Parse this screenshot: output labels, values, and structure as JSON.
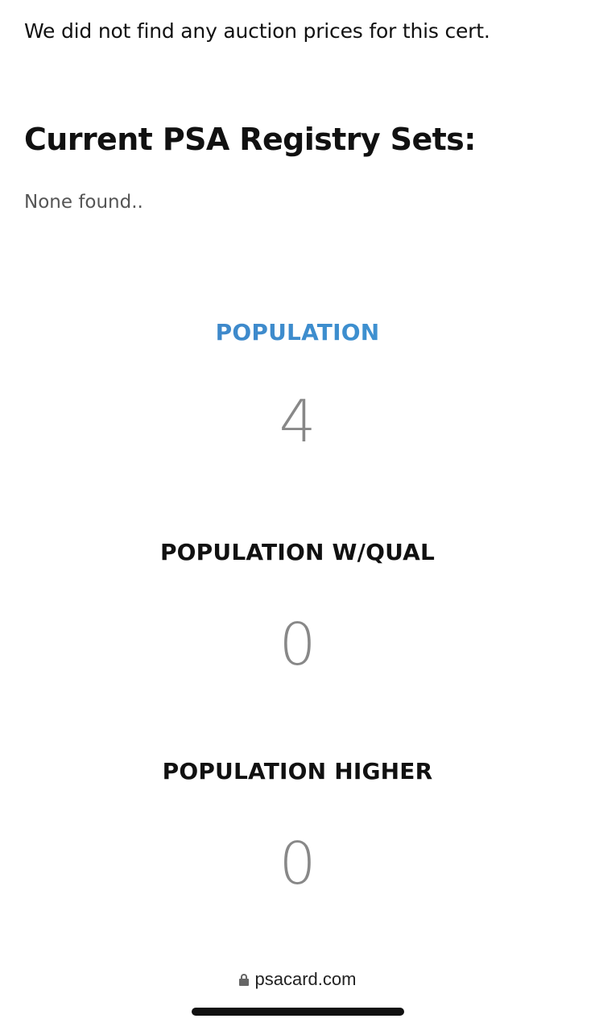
{
  "auction": {
    "message": "We did not find any auction prices for this cert."
  },
  "registry": {
    "heading": "Current PSA Registry Sets:",
    "empty_text": "None found.."
  },
  "population": {
    "label": "POPULATION",
    "value": "4",
    "accent_colors": [
      "#3f7fc4",
      "#49a3d8"
    ]
  },
  "population_qual": {
    "label": "POPULATION W/QUAL",
    "value": "0"
  },
  "population_higher": {
    "label": "POPULATION HIGHER",
    "value": "0"
  },
  "browser": {
    "url": "psacard.com",
    "icon": "lock-icon"
  }
}
